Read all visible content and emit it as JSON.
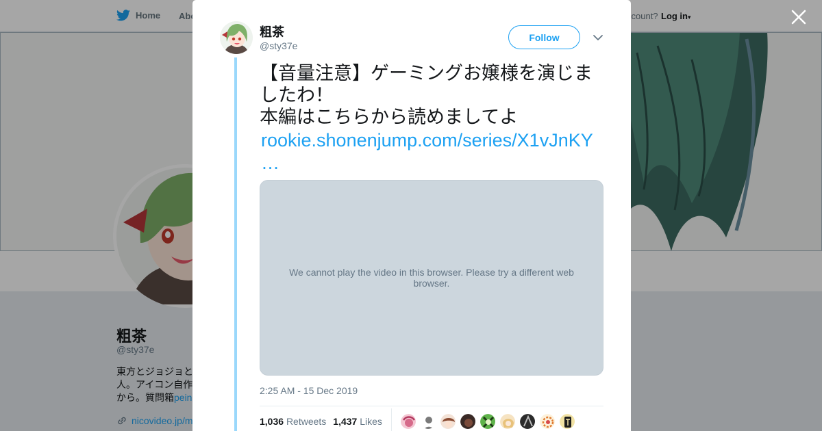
{
  "nav": {
    "home_label": "Home",
    "about_label": "Abo",
    "account_label": "ccount?",
    "login_label": "Log in"
  },
  "profile": {
    "name": "粗茶",
    "handle": "@sty37e",
    "bio_line1": "東方とジョジョと",
    "bio_line2": "人。アイコン自作",
    "bio_line3": "から。質問箱",
    "bio_link": "pein",
    "url": "nicovideo.jp/m"
  },
  "tweet": {
    "author_name": "粗茶",
    "author_handle": "@sty37e",
    "follow_label": "Follow",
    "text_line1": "【音量注意】ゲーミングお嬢様を演じま",
    "text_line2": "したわ！",
    "text_line3": "本編はこちらから読めましてよ",
    "link": "rookie.shonenjump.com/series/X1vJnKY",
    "link_ellipsis": "…",
    "video_message": "We cannot play the video in this browser. Please try a different web browser.",
    "timestamp": "2:25 AM - 15 Dec 2019",
    "retweets_count": "1,036",
    "retweets_label": "Retweets",
    "likes_count": "1,437",
    "likes_label": "Likes"
  },
  "colors": {
    "accent": "#1da1f2",
    "thread_line": "#9ad8fb",
    "video_bg": "#ccd6dd",
    "avatar_hair": "#7fb069"
  },
  "icons": {
    "close": "close-icon",
    "caret": "chevron-down-icon",
    "twitter": "twitter-bird-icon",
    "link": "link-icon"
  }
}
